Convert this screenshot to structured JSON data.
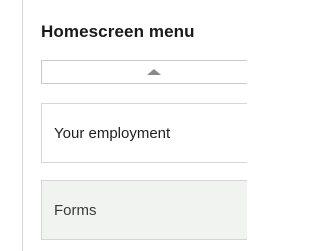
{
  "menu": {
    "title": "Homescreen menu",
    "scroll_up_icon": "triangle-up",
    "items": [
      {
        "label": "Your employment"
      },
      {
        "label": "Forms"
      }
    ]
  },
  "colors": {
    "background": "#ffffff",
    "border": "#d6d6d6",
    "selected_item_background": "#f1f3f1",
    "arrow": "#8a8a8a"
  }
}
